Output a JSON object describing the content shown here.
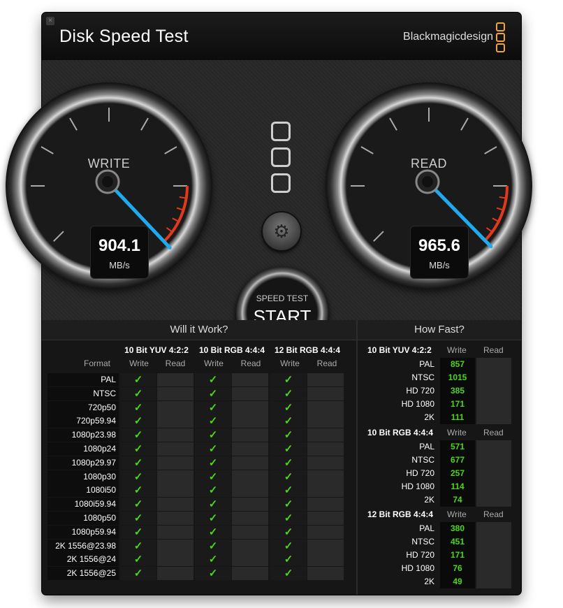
{
  "window": {
    "title": "Disk Speed Test",
    "brand": "Blackmagicdesign",
    "close_glyph": "×"
  },
  "gauges": {
    "write": {
      "label": "WRITE",
      "value": "904.1",
      "unit": "MB/s",
      "needle_value": 904.1
    },
    "read": {
      "label": "READ",
      "value": "965.6",
      "unit": "MB/s",
      "needle_value": 965.6
    }
  },
  "controls": {
    "start_small": "SPEED TEST",
    "start_big": "START",
    "settings_icon": "gear-icon",
    "settings_glyph": "⚙"
  },
  "will_it_work": {
    "title": "Will it Work?",
    "format_label": "Format",
    "groups": [
      "10 Bit YUV 4:2:2",
      "10 Bit RGB 4:4:4",
      "12 Bit RGB 4:4:4"
    ],
    "sub_write": "Write",
    "sub_read": "Read",
    "check_glyph": "✓",
    "rows": [
      "PAL",
      "NTSC",
      "720p50",
      "720p59.94",
      "1080p23.98",
      "1080p24",
      "1080p29.97",
      "1080p30",
      "1080i50",
      "1080i59.94",
      "1080p50",
      "1080p59.94",
      "2K 1556@23.98",
      "2K 1556@24",
      "2K 1556@25"
    ]
  },
  "how_fast": {
    "title": "How Fast?",
    "write_label": "Write",
    "read_label": "Read",
    "sections": [
      {
        "title": "10 Bit YUV 4:2:2",
        "rows": [
          {
            "label": "PAL",
            "write": "857"
          },
          {
            "label": "NTSC",
            "write": "1015"
          },
          {
            "label": "HD 720",
            "write": "385"
          },
          {
            "label": "HD 1080",
            "write": "171"
          },
          {
            "label": "2K",
            "write": "111"
          }
        ]
      },
      {
        "title": "10 Bit RGB 4:4:4",
        "rows": [
          {
            "label": "PAL",
            "write": "571"
          },
          {
            "label": "NTSC",
            "write": "677"
          },
          {
            "label": "HD 720",
            "write": "257"
          },
          {
            "label": "HD 1080",
            "write": "114"
          },
          {
            "label": "2K",
            "write": "74"
          }
        ]
      },
      {
        "title": "12 Bit RGB 4:4:4",
        "rows": [
          {
            "label": "PAL",
            "write": "380"
          },
          {
            "label": "NTSC",
            "write": "451"
          },
          {
            "label": "HD 720",
            "write": "171"
          },
          {
            "label": "HD 1080",
            "write": "76"
          },
          {
            "label": "2K",
            "write": "49"
          }
        ]
      }
    ]
  },
  "colors": {
    "accent_needle": "#1eaaf0",
    "check_green": "#4cd61a",
    "redzone": "#e03a1c",
    "logo_orange": "#f2a43a"
  }
}
